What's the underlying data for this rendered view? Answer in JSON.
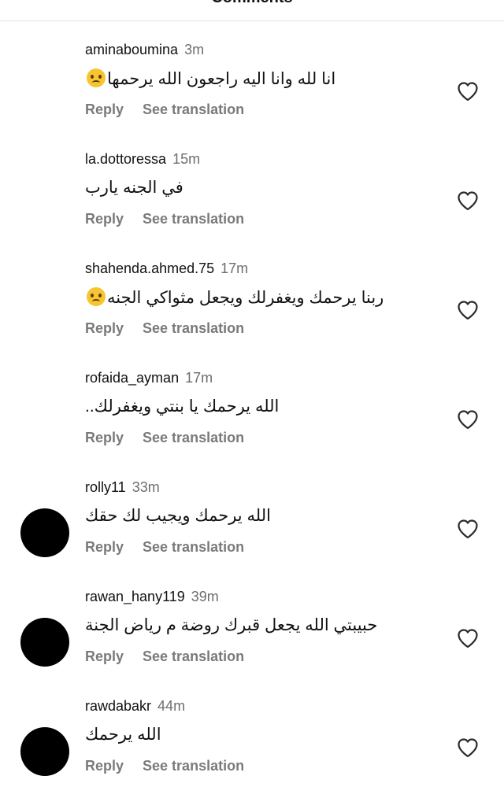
{
  "header": {
    "title": "Comments"
  },
  "comments": [
    {
      "username": "aminaboumina",
      "time": "3m",
      "text": "انا لله وانا اليه راجعون الله يرحمها",
      "has_avatar": false,
      "emoji": true
    },
    {
      "username": "la.dottoressa",
      "time": "15m",
      "text": "في الجنه يارب",
      "has_avatar": false,
      "emoji": false
    },
    {
      "username": "shahenda.ahmed.75",
      "time": "17m",
      "text": "ربنا يرحمك ويغفرلك ويجعل مثواكي الجنه",
      "has_avatar": false,
      "emoji": true
    },
    {
      "username": "rofaida_ayman",
      "time": "17m",
      "text": "الله يرحمك يا بنتي ويغفرلك..",
      "has_avatar": false,
      "emoji": false
    },
    {
      "username": "rolly11",
      "time": "33m",
      "text": "الله يرحمك ويجيب لك حقك",
      "has_avatar": true,
      "emoji": false
    },
    {
      "username": "rawan_hany119",
      "time": "39m",
      "text": "حبيبتي الله يجعل قبرك روضة م رياض الجنة",
      "has_avatar": true,
      "emoji": false
    },
    {
      "username": "rawdabakr",
      "time": "44m",
      "text": "الله يرحمك",
      "has_avatar": true,
      "emoji": false
    }
  ],
  "actions": {
    "reply_label": "Reply",
    "translate_label": "See translation"
  },
  "icons": {
    "like": "heart-outline-icon",
    "emoji": "crying-face-icon"
  },
  "colors": {
    "secondary_text": "#7a7a7a",
    "avatar": "#000000"
  }
}
